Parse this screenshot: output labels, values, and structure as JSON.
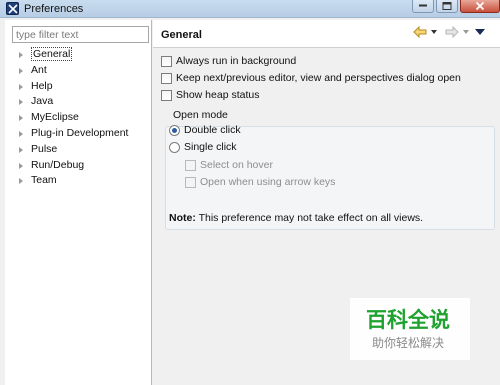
{
  "window": {
    "title": "Preferences",
    "app_icon": "eclipse-x-icon"
  },
  "sidebar": {
    "filter_placeholder": "type filter text",
    "items": [
      {
        "label": "General",
        "selected": true
      },
      {
        "label": "Ant"
      },
      {
        "label": "Help"
      },
      {
        "label": "Java"
      },
      {
        "label": "MyEclipse"
      },
      {
        "label": "Plug-in Development"
      },
      {
        "label": "Pulse"
      },
      {
        "label": "Run/Debug"
      },
      {
        "label": "Team"
      }
    ]
  },
  "page": {
    "title": "General",
    "nav_icons": [
      "back-arrow-icon",
      "forward-arrow-icon",
      "view-menu-icon"
    ],
    "options": {
      "always_run_background": "Always run in background",
      "keep_dialog_open": "Keep next/previous editor, view and perspectives dialog open",
      "show_heap_status": "Show heap status"
    },
    "open_mode": {
      "title": "Open mode",
      "double_click": "Double click",
      "single_click": "Single click",
      "select_on_hover": "Select on hover",
      "open_arrow_keys": "Open when using arrow keys",
      "selected": "Double click"
    },
    "note": {
      "label": "Note:",
      "text": " This preference may not take effect on all views."
    }
  },
  "watermark": {
    "main": "百科全说",
    "sub": "助你轻松解决"
  },
  "colors": {
    "watermark_green": "#1fa22f",
    "radio_dot": "#2f5b9e"
  }
}
